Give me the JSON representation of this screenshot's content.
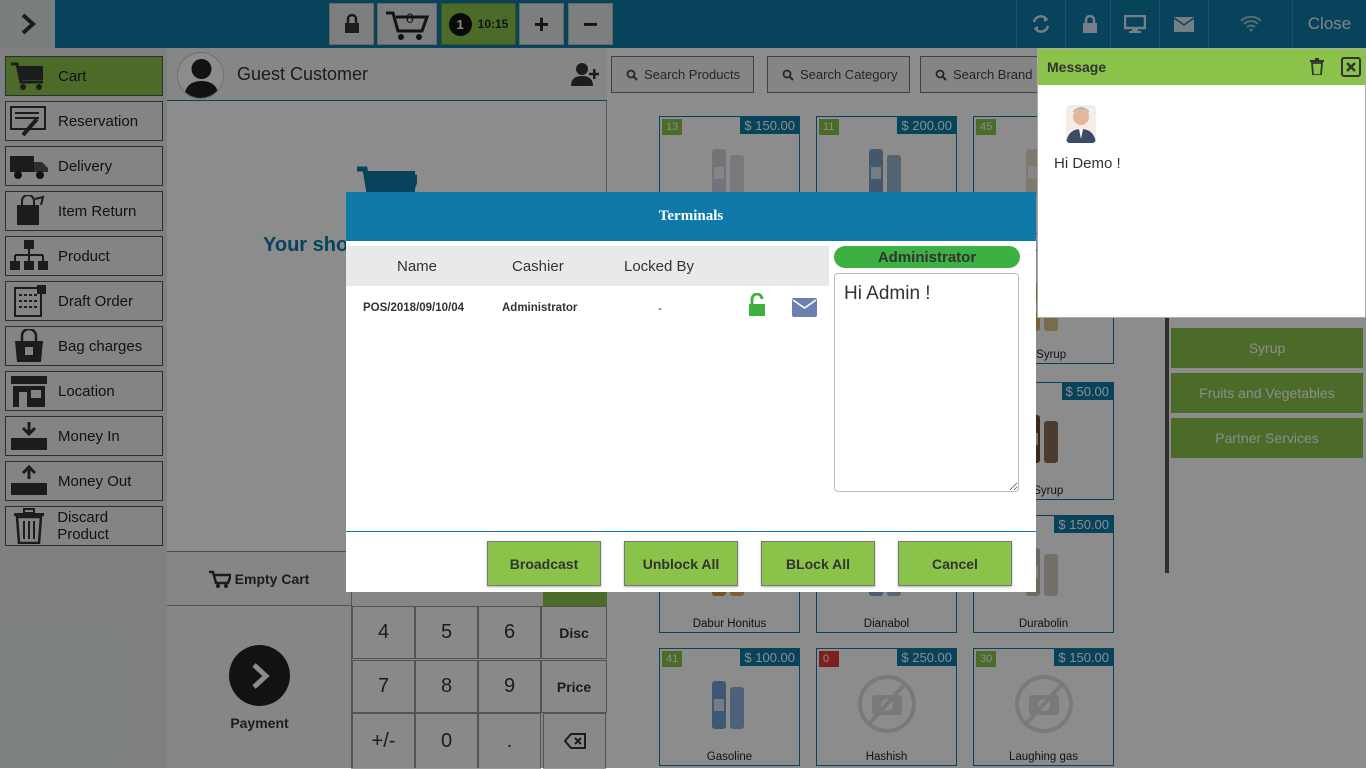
{
  "topbar": {
    "cart_count": "0",
    "order_number": "1",
    "time": "10:15",
    "plus_label": "+",
    "minus_label": "−",
    "close_label": "Close"
  },
  "menu": [
    {
      "label": "Cart",
      "icon": "cart-icon"
    },
    {
      "label": "Reservation",
      "icon": "reservation-icon"
    },
    {
      "label": "Delivery",
      "icon": "truck-icon"
    },
    {
      "label": "Item Return",
      "icon": "return-bag-icon"
    },
    {
      "label": "Product",
      "icon": "product-tree-icon"
    },
    {
      "label": "Draft Order",
      "icon": "draft-icon"
    },
    {
      "label": "Bag charges",
      "icon": "bag-icon"
    },
    {
      "label": "Location",
      "icon": "store-icon"
    },
    {
      "label": "Money In",
      "icon": "money-in-icon"
    },
    {
      "label": "Money Out",
      "icon": "money-out-icon"
    },
    {
      "label": "Discard Product",
      "icon": "trash-icon"
    }
  ],
  "customer": {
    "name": "Guest Customer"
  },
  "cart": {
    "empty_text": "Your shop"
  },
  "bottom": {
    "empty_cart": "Empty Cart",
    "payment": "Payment",
    "keys": [
      "4",
      "5",
      "6",
      "Disc",
      "7",
      "8",
      "9",
      "Price",
      "+/-",
      "0",
      "."
    ]
  },
  "search": {
    "products": "Search Products",
    "category": "Search Category",
    "brand": "Search Brand"
  },
  "products": [
    {
      "stock": "13",
      "price": "$ 150.00",
      "name": ""
    },
    {
      "stock": "11",
      "price": "$ 200.00",
      "name": ""
    },
    {
      "stock": "45",
      "price": "",
      "name": ""
    },
    {
      "stock": "",
      "price": "",
      "name": "ryl Syrup"
    },
    {
      "stock": "",
      "price": "$ 50.00",
      "name": "h Syrup"
    },
    {
      "stock": "",
      "price": "",
      "name": "Dabur Honitus"
    },
    {
      "stock": "",
      "price": "",
      "name": "Dianabol"
    },
    {
      "stock": "",
      "price": "$ 150.00",
      "name": "Durabolin"
    },
    {
      "stock": "41",
      "price": "$ 100.00",
      "name": "Gasoline"
    },
    {
      "stock": "0",
      "price": "$ 250.00",
      "name": "Hashish"
    },
    {
      "stock": "30",
      "price": "$ 150.00",
      "name": "Laughing gas"
    }
  ],
  "categories": [
    "Syrup",
    "Fruits and Vegetables",
    "Partner Services"
  ],
  "message": {
    "title": "Message",
    "text": "Hi Demo !"
  },
  "modal": {
    "title": "Terminals",
    "columns": [
      "Name",
      "Cashier",
      "Locked By"
    ],
    "rows": [
      {
        "name": "POS/2018/09/10/04",
        "cashier": "Administrator",
        "locked_by": "-"
      }
    ],
    "recipient": "Administrator",
    "message_text": "Hi Admin !",
    "buttons": [
      "Broadcast",
      "Unblock All",
      "BLock All",
      "Cancel"
    ]
  },
  "colors": {
    "primary": "#0f7aa8",
    "accent": "#8bc34a",
    "unlock": "#3cb043"
  }
}
